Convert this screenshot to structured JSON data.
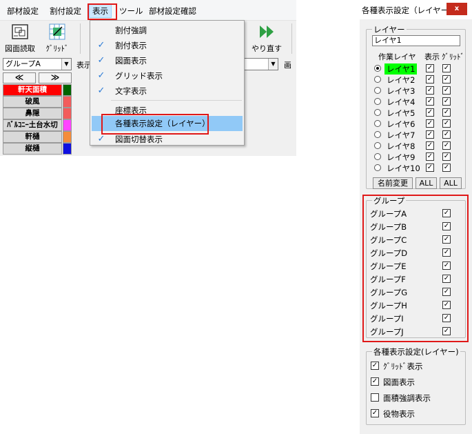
{
  "menubar": {
    "items": [
      "部材設定",
      "割付設定",
      "表示",
      "ツール",
      "部材設定確認"
    ]
  },
  "toolbar": {
    "drawing_read": "図面読取",
    "grid": "ｸﾞﾘｯﾄﾞ",
    "redo": "やり直す"
  },
  "selectors": {
    "group": "グループA",
    "display_prefix": "表示",
    "drawing_prefix": "画"
  },
  "nav": {
    "prev": "≪",
    "next": "≫"
  },
  "members": [
    {
      "name": "軒天面積",
      "color": "#ff0000",
      "text_color": "#ffffff",
      "swatch": "#006400"
    },
    {
      "name": "破風",
      "color": "#d9d9d9",
      "text_color": "#000000",
      "swatch": "#f25c5c"
    },
    {
      "name": "鼻隠",
      "color": "#d9d9d9",
      "text_color": "#000000",
      "swatch": "#f25c5c"
    },
    {
      "name": "ﾊﾞﾙｺﾆｰ土台水切",
      "color": "#d9d9d9",
      "text_color": "#000000",
      "swatch": "#ff44ff"
    },
    {
      "name": "軒樋",
      "color": "#d9d9d9",
      "text_color": "#000000",
      "swatch": "#f58c3a"
    },
    {
      "name": "縦樋",
      "color": "#d9d9d9",
      "text_color": "#000000",
      "swatch": "#1010e0"
    }
  ],
  "dropdown": {
    "items": [
      {
        "label": "割付強調",
        "checked": false
      },
      {
        "label": "割付表示",
        "checked": true
      },
      {
        "label": "図面表示",
        "checked": true
      },
      {
        "label": "グリッド表示",
        "checked": true
      },
      {
        "label": "文字表示",
        "checked": true
      },
      {
        "label": "座標表示",
        "checked": false
      },
      {
        "label": "各種表示設定（レイヤー）",
        "checked": false,
        "highlighted": true
      },
      {
        "label": "図面切替表示",
        "checked": true
      }
    ],
    "check_glyph": "✓"
  },
  "dialog": {
    "title": "各種表示設定（レイヤー）",
    "close": "x",
    "layer_section": {
      "legend": "レイヤー",
      "name_value": "レイヤ1",
      "headers": [
        "作業レイヤ",
        "表示",
        "ｸﾞﾘｯﾄﾞ"
      ],
      "layers": [
        {
          "name": "レイヤ1",
          "selected": true,
          "show": true,
          "grid": true
        },
        {
          "name": "レイヤ2",
          "selected": false,
          "show": true,
          "grid": true
        },
        {
          "name": "レイヤ3",
          "selected": false,
          "show": true,
          "grid": true
        },
        {
          "name": "レイヤ4",
          "selected": false,
          "show": true,
          "grid": true
        },
        {
          "name": "レイヤ5",
          "selected": false,
          "show": true,
          "grid": true
        },
        {
          "name": "レイヤ6",
          "selected": false,
          "show": true,
          "grid": true
        },
        {
          "name": "レイヤ7",
          "selected": false,
          "show": true,
          "grid": true
        },
        {
          "name": "レイヤ8",
          "selected": false,
          "show": true,
          "grid": true
        },
        {
          "name": "レイヤ9",
          "selected": false,
          "show": true,
          "grid": true
        },
        {
          "name": "レイヤ10",
          "selected": false,
          "show": true,
          "grid": true
        }
      ],
      "rename_button": "名前変更",
      "all_show_button": "ALL",
      "all_grid_button": "ALL",
      "active_color": "#00ff00"
    },
    "group_section": {
      "legend": "グループ",
      "groups": [
        {
          "name": "グループA",
          "checked": true
        },
        {
          "name": "グループB",
          "checked": true
        },
        {
          "name": "グループC",
          "checked": true
        },
        {
          "name": "グループD",
          "checked": true
        },
        {
          "name": "グループE",
          "checked": true
        },
        {
          "name": "グループF",
          "checked": true
        },
        {
          "name": "グループG",
          "checked": true
        },
        {
          "name": "グループH",
          "checked": true
        },
        {
          "name": "グループI",
          "checked": true
        },
        {
          "name": "グループJ",
          "checked": true
        }
      ]
    },
    "settings_section": {
      "legend": "各種表示設定(レイヤー)",
      "options": [
        {
          "label": "ｸﾞﾘｯﾄﾞ表示",
          "checked": true
        },
        {
          "label": "図面表示",
          "checked": true
        },
        {
          "label": "面積強調表示",
          "checked": false
        },
        {
          "label": "役物表示",
          "checked": true
        }
      ]
    },
    "check_mark": "✓"
  },
  "highlight_color": "#e01818"
}
